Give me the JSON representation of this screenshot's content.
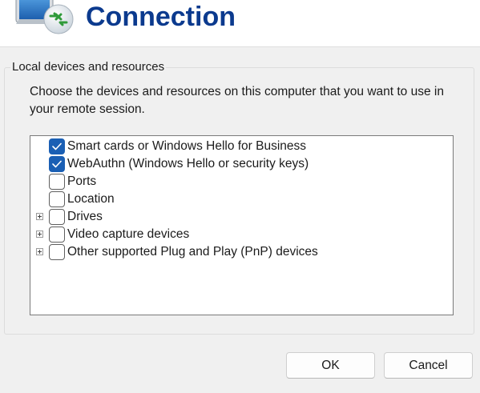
{
  "header": {
    "title": "Connection",
    "icon": "remote-desktop-connection-icon"
  },
  "group": {
    "legend": "Local devices and resources",
    "description": "Choose the devices and resources on this computer that you want to use in your remote session."
  },
  "tree": {
    "items": [
      {
        "label": "Smart cards or Windows Hello for Business",
        "checked": true,
        "expandable": false
      },
      {
        "label": "WebAuthn (Windows Hello or security keys)",
        "checked": true,
        "expandable": false
      },
      {
        "label": "Ports",
        "checked": false,
        "expandable": false
      },
      {
        "label": "Location",
        "checked": false,
        "expandable": false
      },
      {
        "label": "Drives",
        "checked": false,
        "expandable": true
      },
      {
        "label": "Video capture devices",
        "checked": false,
        "expandable": true
      },
      {
        "label": "Other supported Plug and Play (PnP) devices",
        "checked": false,
        "expandable": true
      }
    ]
  },
  "buttons": {
    "ok": "OK",
    "cancel": "Cancel"
  },
  "colors": {
    "title": "#0b3a8e",
    "checkbox_checked": "#1a5fb4"
  }
}
